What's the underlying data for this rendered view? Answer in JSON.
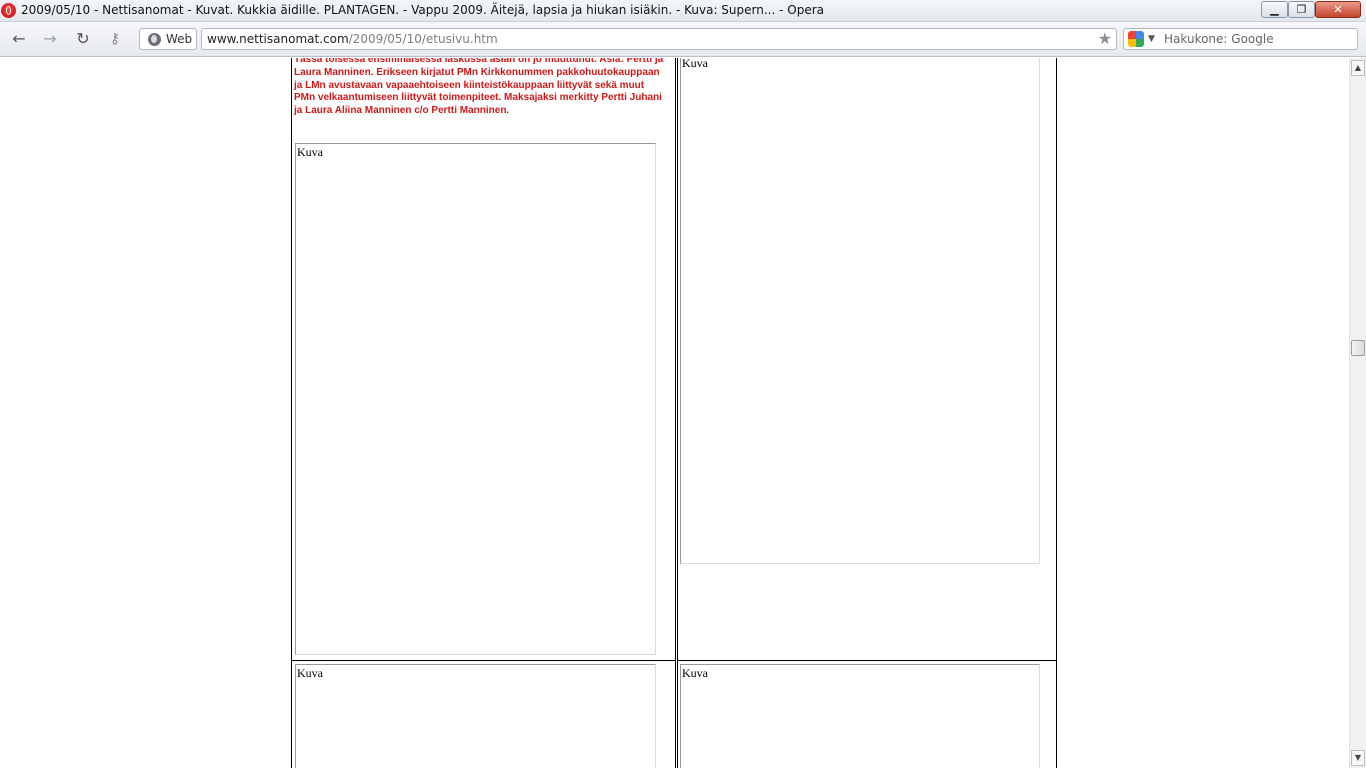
{
  "window": {
    "title": "2009/05/10 - Nettisanomat - Kuvat. Kukkia äidille. PLANTAGEN. - Vappu 2009. Äitejä, lapsia ja hiukan isiäkin. - Kuva: Supern... - Opera",
    "minimize": "▁",
    "maximize": "❐",
    "close": "✕"
  },
  "toolbar": {
    "back": "←",
    "forward": "→",
    "reload": "↻",
    "key": "⚷",
    "web_label": "Web",
    "url_host": "www.nettisanomat.com",
    "url_path": "/2009/05/10/etusivu.htm",
    "bookmark": "★",
    "search_placeholder": "Hakukone: Google",
    "dropdown": "▼"
  },
  "content": {
    "red_text": "Tässä toisessa ensimmäisessä laskussa asian on jo muuttunut.  Asia: Pertti ja Laura Manninen. Erikseen kirjatut PMn Kirkkonummen pakkohuutokauppaan ja LMn avustavaan vapaaehtoiseen kiinteistökauppaan liittyvät sekä muut PMn velkaantumiseen liittyvät toimenpiteet. Maksajaksi merkitty Pertti Juhani  ja Laura Aliina Manninen c/o Pertti Manninen.",
    "images": [
      "Kuva",
      "Kuva",
      "Kuva",
      "Kuva"
    ]
  },
  "scrollbar": {
    "up": "▲",
    "down": "▼"
  }
}
